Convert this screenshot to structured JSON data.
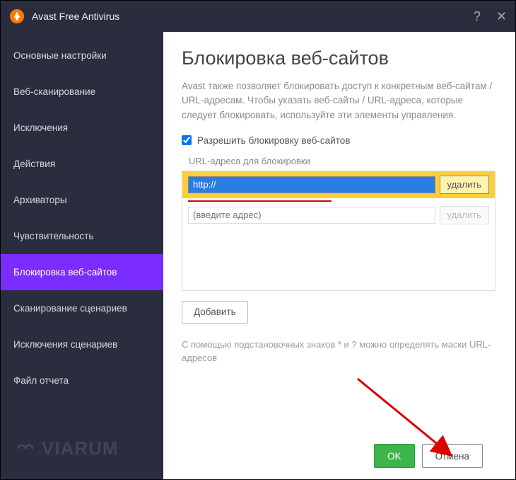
{
  "titlebar": {
    "title": "Avast Free Antivirus"
  },
  "sidebar": {
    "items": [
      {
        "label": "Основные настройки"
      },
      {
        "label": "Веб-сканирование"
      },
      {
        "label": "Исключения"
      },
      {
        "label": "Действия"
      },
      {
        "label": "Архиваторы"
      },
      {
        "label": "Чувствительность"
      },
      {
        "label": "Блокировка веб-сайтов"
      },
      {
        "label": "Сканирование сценариев"
      },
      {
        "label": "Исключения сценариев"
      },
      {
        "label": "Файл отчета"
      }
    ],
    "selected_index": 6
  },
  "main": {
    "heading": "Блокировка веб-сайтов",
    "description": "Avast также позволяет блокировать доступ к конкретным веб-сайтам / URL-адресам. Чтобы указать веб-сайты / URL-адреса, которые следует блокировать, используйте эти элементы управления.",
    "checkbox_label": "Разрешить блокировку веб-сайтов",
    "checkbox_checked": true,
    "list_label": "URL-адреса для блокировки",
    "rows": [
      {
        "value": "http://",
        "selected": true,
        "delete_label": "удалить"
      },
      {
        "placeholder": "(введите адрес)",
        "delete_label": "удалить"
      }
    ],
    "add_button": "Добавить",
    "hint": "С помощью подстановочных знаков * и ? можно определять маски URL-адресов"
  },
  "footer": {
    "ok": "OK",
    "cancel": "Отмена"
  },
  "watermark": "VIARUM"
}
